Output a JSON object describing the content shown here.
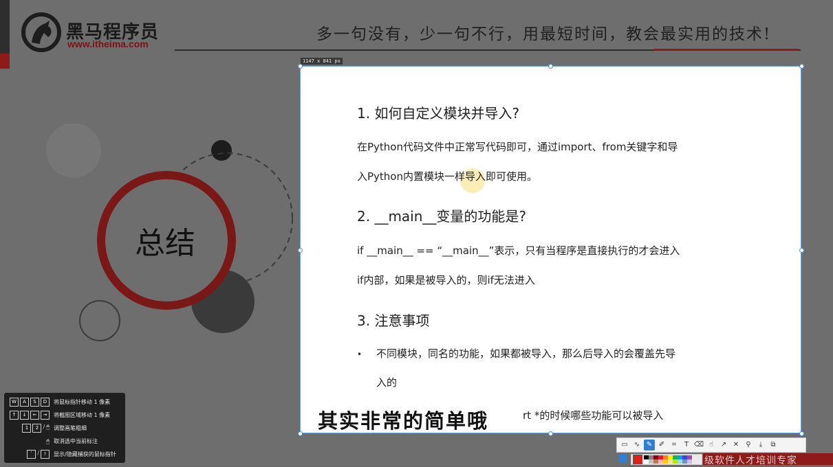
{
  "header": {
    "brand_name": "黑马程序员",
    "brand_url": "www.itheima.com",
    "slogan": "多一句没有，少一句不行，用最短时间，教会最实用的技术!"
  },
  "slide": {
    "summary_title": "总结"
  },
  "canvas": {
    "size_label": "1147 x 841  px",
    "heading1": "1. 如何自定义模块并导入?",
    "para1_line1": "在Python代码文件中正常写代码即可，通过import、from关键字和导",
    "para1_line2": "入Python内置模块一样导入即可使用。",
    "heading2": "2. __main__变量的功能是?",
    "para2_line1": "if __main__ == “__main__”表示，只有当程序是直接执行的才会进入",
    "para2_line2": "if内部，如果是被导入的，则if无法进入",
    "heading3": "3. 注意事项",
    "bullet1_line1": "不同模块，同名的功能，如果都被导入，那么后导入的会覆盖先导",
    "bullet1_line2": "入的",
    "bullet2_partial": "rt *的时候哪些功能可以被导入"
  },
  "subtitle": "其实非常的简单哦",
  "shortcuts": [
    {
      "keys": [
        "W",
        "A",
        "S",
        "D"
      ],
      "label": "将鼠标指针移动 1 像素"
    },
    {
      "keys": [
        "↑",
        "↓",
        "←",
        "→"
      ],
      "label": "将截图区域移动 1 像素"
    },
    {
      "keys": [
        "1",
        "2",
        "/",
        "🖱"
      ],
      "label": "调整画笔粗细"
    },
    {
      "keys": [
        "🖱"
      ],
      "label": "取消选中当前标注"
    },
    {
      "keys": [
        "`",
        "/",
        "!"
      ],
      "label": "显示/隐藏捕获的鼠标指针"
    }
  ],
  "toolbar": {
    "tools": [
      "rect-select",
      "line",
      "pen",
      "highlighter",
      "crop",
      "text",
      "eraser",
      "pointer",
      "arrow",
      "close",
      "pin",
      "save",
      "copy"
    ]
  },
  "palette": {
    "current_color": "#e0201b",
    "colors": [
      "#000000",
      "#7f7f7f",
      "#880015",
      "#ed1c24",
      "#ff7f27",
      "#fff200",
      "#22b14c",
      "#00a2e8",
      "#3f48cc",
      "#a349a4",
      "#ffffff",
      "#c3c3c3",
      "#b97a57",
      "#ffaec9",
      "#ffc90e",
      "#efe4b0",
      "#b5e61d",
      "#99d9ea",
      "#7092be",
      "#c8bfe7"
    ]
  },
  "footer_text": "级软件人才培训专家",
  "colors": {
    "brand_red": "#8e1a1a",
    "selection_blue": "#4b8fdc",
    "slide_gray": "#6e6e6e"
  }
}
